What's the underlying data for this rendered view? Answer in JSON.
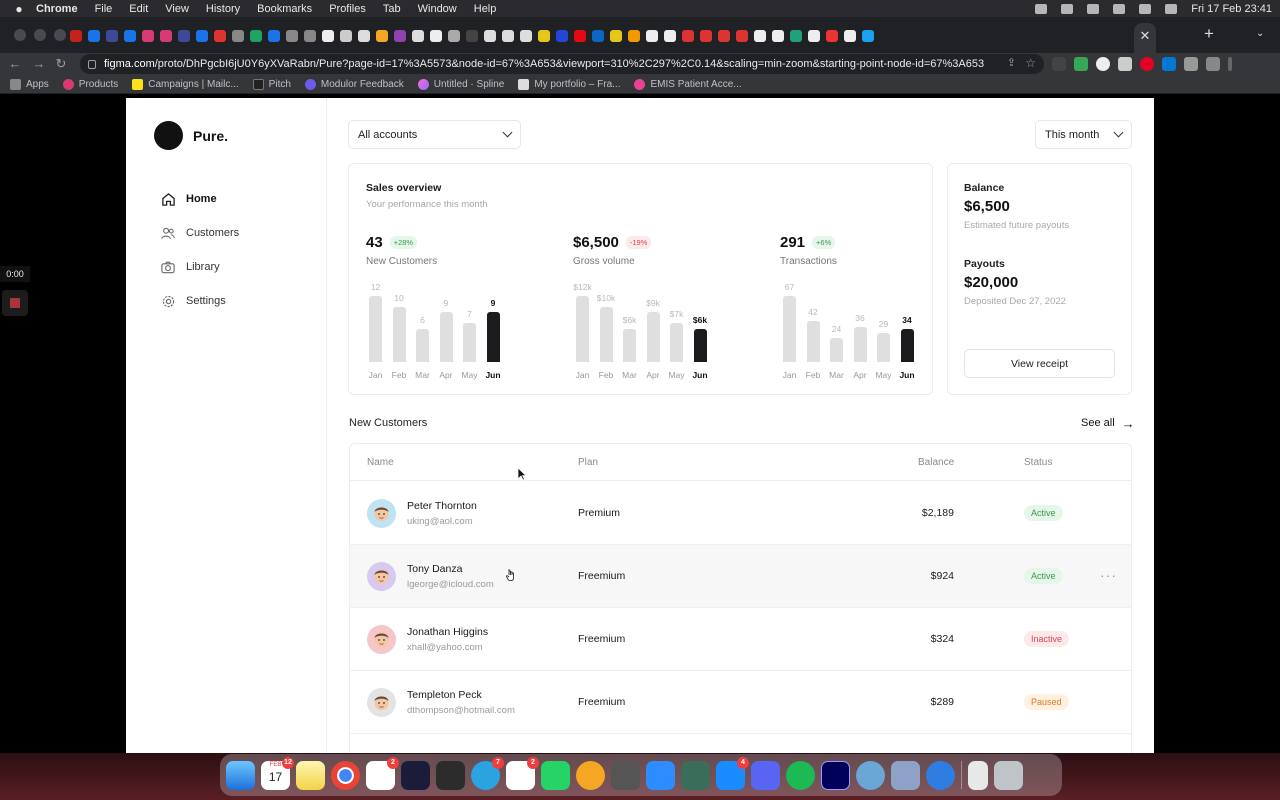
{
  "menubar": {
    "items": [
      "Chrome",
      "File",
      "Edit",
      "View",
      "History",
      "Bookmarks",
      "Profiles",
      "Tab",
      "Window",
      "Help"
    ],
    "clock": "Fri 17 Feb  23:41"
  },
  "browser": {
    "url_domain": "figma.com",
    "url_path": "/proto/DhPgcbI6jU0Y6yXVaRabn/Pure?page-id=17%3A5573&node-id=67%3A653&viewport=310%2C297%2C0.14&scaling=min-zoom&starting-point-node-id=67%3A653",
    "bookmarks": [
      "Apps",
      "Products",
      "Campaigns | Mailc...",
      "Pitch",
      "Modulor Feedback",
      "Untitled · Spline",
      "My portfolio – Fra...",
      "EMIS Patient Acce..."
    ]
  },
  "recorder": {
    "time": "0:00"
  },
  "app": {
    "brand": "Pure.",
    "nav": [
      "Home",
      "Customers",
      "Library",
      "Settings"
    ],
    "account_filter": "All accounts",
    "period_filter": "This month"
  },
  "sales": {
    "title": "Sales overview",
    "subtitle": "Your performance this month",
    "metrics": [
      {
        "value": "43",
        "change": "+28%",
        "trend": "up",
        "label": "New Customers",
        "months": [
          "Jan",
          "Feb",
          "Mar",
          "Apr",
          "May",
          "Jun"
        ],
        "bars": [
          12,
          10,
          6,
          9,
          7,
          9
        ],
        "bar_labels": [
          "12",
          "10",
          "6",
          "9",
          "7",
          "9"
        ]
      },
      {
        "value": "$6,500",
        "change": "-19%",
        "trend": "down",
        "label": "Gross volume",
        "months": [
          "Jan",
          "Feb",
          "Mar",
          "Apr",
          "May",
          "Jun"
        ],
        "bars": [
          12,
          10,
          6,
          9,
          7,
          6
        ],
        "bar_labels": [
          "$12k",
          "$10k",
          "$6k",
          "$9k",
          "$7k",
          "$6k"
        ]
      },
      {
        "value": "291",
        "change": "+6%",
        "trend": "up",
        "label": "Transactions",
        "months": [
          "Jan",
          "Feb",
          "Mar",
          "Apr",
          "May",
          "Jun"
        ],
        "bars": [
          67,
          42,
          24,
          36,
          29,
          34
        ],
        "bar_labels": [
          "67",
          "42",
          "24",
          "36",
          "29",
          "34"
        ]
      }
    ]
  },
  "balance": {
    "balance_label": "Balance",
    "balance_value": "$6,500",
    "balance_sub": "Estimated future payouts",
    "payouts_label": "Payouts",
    "payouts_value": "$20,000",
    "payouts_sub": "Deposited Dec 27, 2022",
    "button": "View receipt"
  },
  "customers": {
    "title": "New Customers",
    "see_all": "See all",
    "columns": [
      "Name",
      "Plan",
      "Balance",
      "Status"
    ],
    "rows": [
      {
        "name": "Peter Thornton",
        "email": "uking@aol.com",
        "plan": "Premium",
        "balance": "$2,189",
        "status": "Active",
        "status_type": "active",
        "avatar_color": "#bfe3f3"
      },
      {
        "name": "Tony Danza",
        "email": "lgeorge@icloud.com",
        "plan": "Freemium",
        "balance": "$924",
        "status": "Active",
        "status_type": "active",
        "avatar_color": "#d8c9f0"
      },
      {
        "name": "Jonathan Higgins",
        "email": "xhall@yahoo.com",
        "plan": "Freemium",
        "balance": "$324",
        "status": "Inactive",
        "status_type": "inactive",
        "avatar_color": "#f6c6c9"
      },
      {
        "name": "Templeton Peck",
        "email": "dthompson@hotmail.com",
        "plan": "Freemium",
        "balance": "$289",
        "status": "Paused",
        "status_type": "paused",
        "avatar_color": "#e3e3e3"
      }
    ]
  },
  "dock": {
    "badges": {
      "calendar": "12",
      "slack": "2",
      "telegram": "7",
      "notion": "2",
      "appstore": "4"
    },
    "calendar_month": "FEB",
    "calendar_day": "17"
  }
}
